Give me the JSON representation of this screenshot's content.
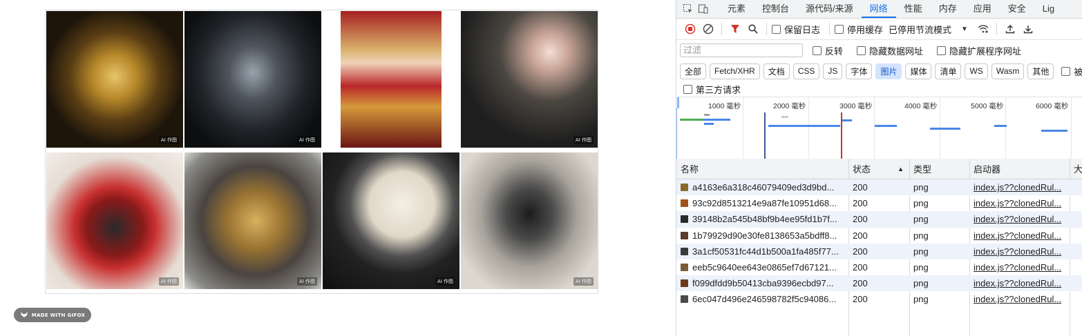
{
  "gallery": {
    "badge": "AI 作图",
    "tiles": [
      {
        "name": "gold-mecha-tile",
        "colors": [
          "#3b2a12",
          "#c9962c",
          "#1a1208"
        ]
      },
      {
        "name": "dark-dragon-knight-tile",
        "colors": [
          "#1c1f24",
          "#6b7480",
          "#0d0f12"
        ]
      },
      {
        "name": "red-armor-girl-tile",
        "colors": [
          "#7a1212",
          "#d4a040",
          "#2a2a38"
        ]
      },
      {
        "name": "dragon-lotus-tile",
        "colors": [
          "#2a2a2a",
          "#c7b7a0",
          "#121212"
        ]
      },
      {
        "name": "red-beast-tile",
        "colors": [
          "#e9e2dc",
          "#a01818",
          "#2a2a2a"
        ]
      },
      {
        "name": "golden-dragon-tile",
        "colors": [
          "#6a6a66",
          "#b08a44",
          "#2c2c2c"
        ]
      },
      {
        "name": "moon-dragon-tile",
        "colors": [
          "#1a1a1a",
          "#e8e2d4",
          "#3a3a3a"
        ]
      },
      {
        "name": "silver-mecha-tile",
        "colors": [
          "#cfcac0",
          "#3a3a3a",
          "#9a2a1a"
        ]
      }
    ],
    "watermark": "MADE WITH GIFOX"
  },
  "devtools": {
    "tabs": [
      "元素",
      "控制台",
      "源代码/来源",
      "网络",
      "性能",
      "内存",
      "应用",
      "安全",
      "Lig"
    ],
    "active_tab": "网络",
    "toolbar": {
      "preserve_log": "保留日志",
      "disable_cache": "停用缓存",
      "throttle": "已停用节流模式"
    },
    "filter": {
      "placeholder": "过滤",
      "invert": "反转",
      "hide_data_urls": "隐藏数据网址",
      "hide_ext_urls": "隐藏扩展程序网址"
    },
    "types": [
      "全部",
      "Fetch/XHR",
      "文档",
      "CSS",
      "JS",
      "字体",
      "图片",
      "媒体",
      "清单",
      "WS",
      "Wasm",
      "其他"
    ],
    "active_type": "图片",
    "blocked": "被",
    "third_party": "第三方请求",
    "overview_ticks": [
      "1000 毫秒",
      "2000 毫秒",
      "3000 毫秒",
      "4000 毫秒",
      "5000 毫秒",
      "6000 毫秒"
    ],
    "columns": {
      "name": "名称",
      "status": "状态",
      "type": "类型",
      "initiator": "启动器",
      "size": "大"
    },
    "requests": [
      {
        "name": "a4163e6a318c46079409ed3d9bd...",
        "status": "200",
        "type": "png",
        "initiator": "index.js??clonedRul...",
        "thumb": "#8a6a2a"
      },
      {
        "name": "93c92d8513214e9a87fe10951d68...",
        "status": "200",
        "type": "png",
        "initiator": "index.js??clonedRul...",
        "thumb": "#a0521a"
      },
      {
        "name": "39148b2a545b48bf9b4ee95fd1b7f...",
        "status": "200",
        "type": "png",
        "initiator": "index.js??clonedRul...",
        "thumb": "#2a2a2a"
      },
      {
        "name": "1b79929d90e30fe8138653a5bdff8...",
        "status": "200",
        "type": "png",
        "initiator": "index.js??clonedRul...",
        "thumb": "#5a3a2a"
      },
      {
        "name": "3a1cf50531fc44d1b500a1fa485f77...",
        "status": "200",
        "type": "png",
        "initiator": "index.js??clonedRul...",
        "thumb": "#3a3a3a"
      },
      {
        "name": "eeb5c9640ee643e0865ef7d67121...",
        "status": "200",
        "type": "png",
        "initiator": "index.js??clonedRul...",
        "thumb": "#7a5a3a"
      },
      {
        "name": "f099dfdd9b50413cba9396ecbd97...",
        "status": "200",
        "type": "png",
        "initiator": "index.js??clonedRul...",
        "thumb": "#6a3a1a"
      },
      {
        "name": "6ec047d496e246598782f5c94086...",
        "status": "200",
        "type": "png",
        "initiator": "index.js??clonedRul...",
        "thumb": "#4a4a4a"
      }
    ]
  }
}
